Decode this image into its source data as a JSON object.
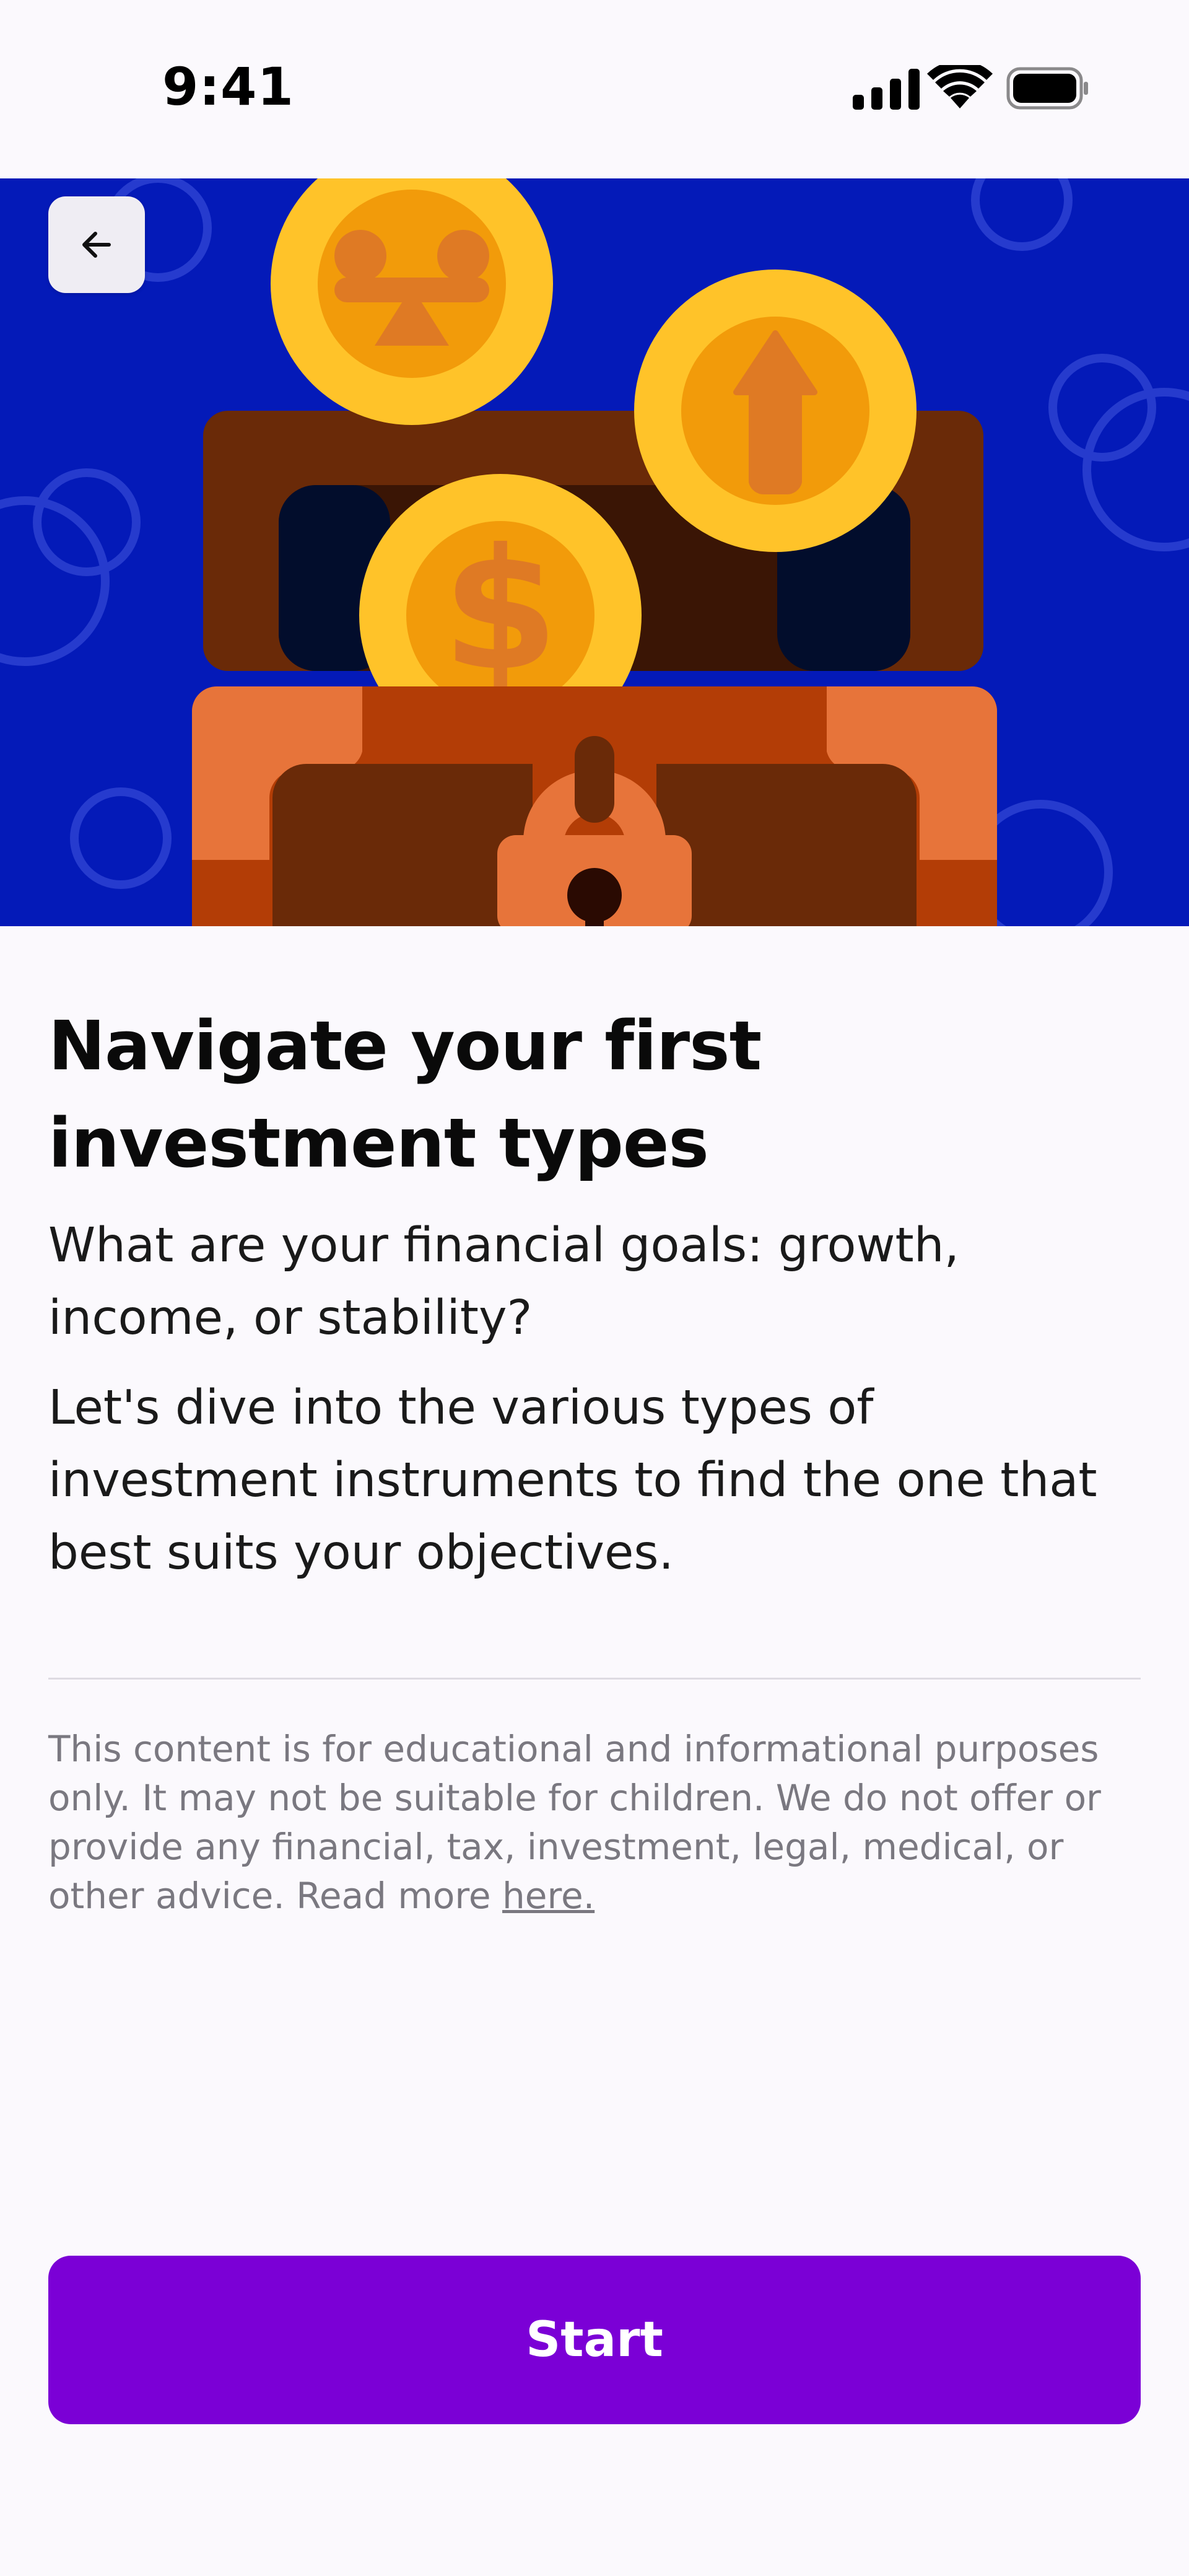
{
  "status_bar": {
    "time": "9:41",
    "icons": [
      "cellular-signal-icon",
      "wifi-icon",
      "battery-icon"
    ]
  },
  "hero": {
    "illustration": "treasure-chest-with-coins",
    "background_color": "#041ab8"
  },
  "back_button": {
    "icon": "arrow-left-icon"
  },
  "content": {
    "title": "Navigate your first investment types",
    "subtitle": "What are your financial goals: growth, income, or stability?",
    "body": "Let's dive into the various types of investment instruments to find the one that best suits your objectives."
  },
  "disclaimer": {
    "text": "This content is for educational and informational purposes only. It may not be suitable for children. We do not offer or provide any financial, tax, investment, legal, medical, or other advice. Read more ",
    "link_label": "here."
  },
  "start_button": {
    "label": "Start",
    "color": "#7b00d6"
  }
}
